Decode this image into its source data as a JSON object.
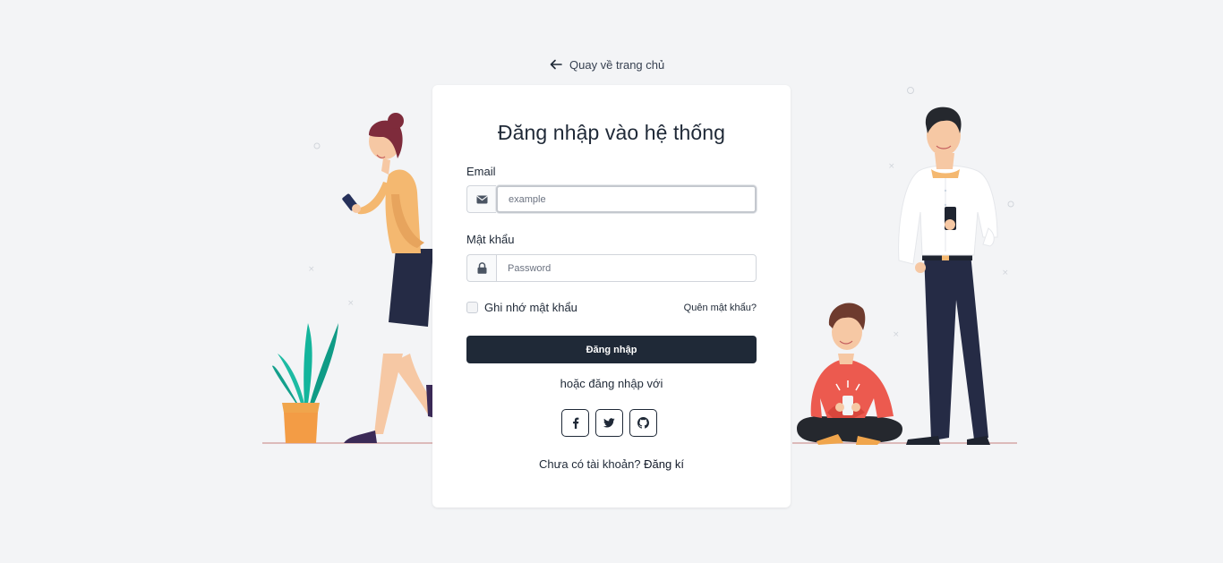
{
  "back_link": {
    "label": "Quay về trang chủ",
    "icon": "arrow-left-icon"
  },
  "card": {
    "title": "Đăng nhập vào hệ thống",
    "email": {
      "label": "Email",
      "placeholder": "example",
      "icon": "envelope-icon"
    },
    "password": {
      "label": "Mật khẩu",
      "placeholder": "Password",
      "icon": "lock-icon"
    },
    "remember_label": "Ghi nhớ mật khẩu",
    "forgot_label": "Quên mật khẩu?",
    "login_label": "Đăng nhập",
    "or_text": "hoặc đăng nhập với",
    "socials": [
      {
        "icon": "facebook-icon"
      },
      {
        "icon": "twitter-icon"
      },
      {
        "icon": "github-icon"
      }
    ],
    "signup_prompt": "Chưa có tài khoản?",
    "signup_link": "Đăng kí"
  },
  "colors": {
    "background": "#f3f4f6",
    "primary_button": "#1f2937",
    "card": "#ffffff"
  }
}
